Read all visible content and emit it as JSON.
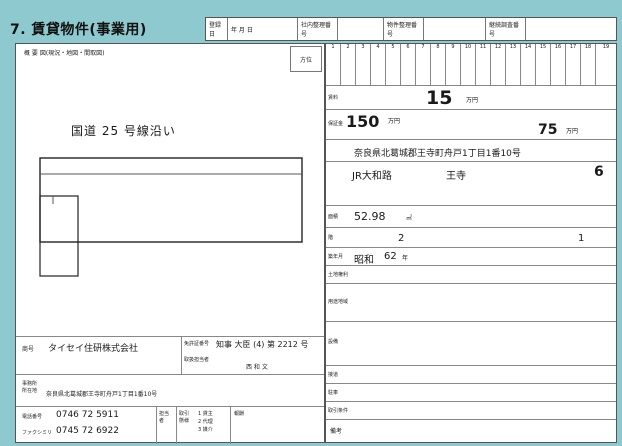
{
  "header": {
    "title": "7. 賃貸物件(事業用)",
    "cells": [
      "登録日",
      "年 月 日",
      "社内整理番号",
      "",
      "物件整理番号",
      "",
      "継続調査番号",
      ""
    ]
  },
  "left_sheet": {
    "map_label": "概 要 図(現況・地図・間取図)",
    "direction": "方位",
    "road_label": "国道 25 号線沿い",
    "company_label": "商号",
    "company_name": "タイセイ住研株式会社",
    "address_label": "事務所所在地",
    "address": "奈良県北葛城郡王寺町舟戸1丁目1番10号",
    "tel_label": "電話番号",
    "tel": "0746 72 5911",
    "fax_label": "ファクシミリ",
    "fax": "0745 72 6922",
    "license_label": "免許証番号",
    "license_value": "知事 大臣 (4) 第 2212 号",
    "staff_label": "取扱担当者",
    "staff": "西 和 文",
    "role_label": "担当者",
    "deal_label": "取引態様",
    "deal_options": [
      "1 貸主",
      "2 代理",
      "3 媒介"
    ],
    "fee_label": "報酬"
  },
  "right_sheet": {
    "column_numbers": [
      "1",
      "2",
      "3",
      "4",
      "5",
      "6",
      "7",
      "8",
      "9",
      "10",
      "11",
      "12",
      "13",
      "14",
      "15",
      "16",
      "17",
      "18",
      "19"
    ],
    "rent_label": "賃料",
    "rent_value": "15",
    "rent_unit": "万円",
    "deposit_label": "保証金",
    "deposit_value": "150",
    "deposit_unit": "万円",
    "amort_value": "75",
    "amort_unit": "万円",
    "address": "奈良県北葛城郡王寺町舟戸1丁目1番10号",
    "transport_line": "JR大和路",
    "transport_station": "王寺",
    "transport_walk": "6",
    "area_value": "52.98",
    "area_unit": "㎡",
    "floor_value": "2",
    "floor_value2": "1",
    "built_era": "昭和",
    "built_year": "62",
    "built_suffix": "年",
    "remarks_label": "備考",
    "sections": [
      "面積",
      "階",
      "築年月",
      "土地権利",
      "用途地域",
      "設備",
      "接道",
      "駐車",
      "取引条件",
      "引渡",
      "更新",
      "備考"
    ]
  }
}
